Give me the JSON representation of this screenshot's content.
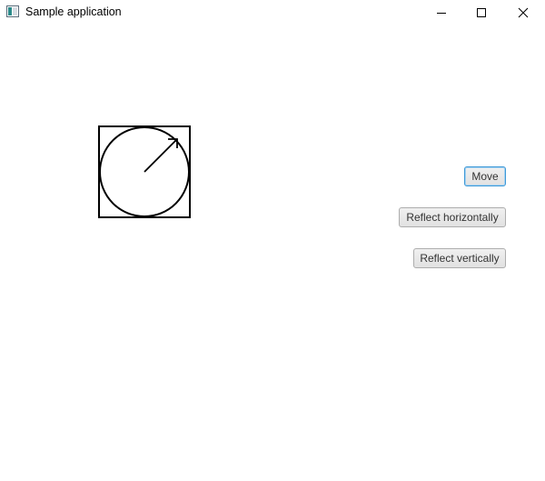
{
  "window": {
    "title": "Sample application",
    "app_icon": "java-app-icon"
  },
  "controls": {
    "minimize_icon": "minimize-icon",
    "maximize_icon": "maximize-icon",
    "close_icon": "close-icon"
  },
  "drawing": {
    "shapes": [
      "square-outline",
      "circle-outline",
      "arrow"
    ],
    "stroke_color": "#000000"
  },
  "buttons": {
    "move_label": "Move",
    "reflect_horizontal_label": "Reflect horizontally",
    "reflect_vertical_label": "Reflect vertically",
    "focused": "Move"
  },
  "colors": {
    "focus_border": "#3d98d6",
    "button_border": "#adadad",
    "button_text": "#333333"
  }
}
